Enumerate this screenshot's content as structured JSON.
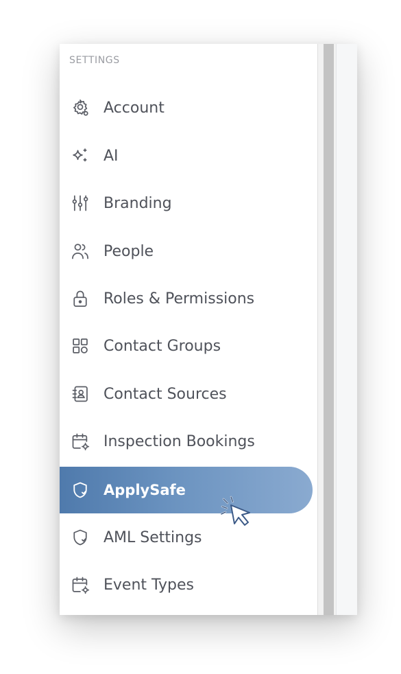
{
  "sidebar": {
    "section_title": "SETTINGS",
    "active_index": 8,
    "accent_gradient": [
      "#4f7aac",
      "#8aaad0"
    ],
    "items": [
      {
        "label": "Account",
        "icon": "gear-icon"
      },
      {
        "label": "AI",
        "icon": "sparkles-icon"
      },
      {
        "label": "Branding",
        "icon": "sliders-icon"
      },
      {
        "label": "People",
        "icon": "people-icon"
      },
      {
        "label": "Roles & Permissions",
        "icon": "lock-icon"
      },
      {
        "label": "Contact Groups",
        "icon": "grid-icon"
      },
      {
        "label": "Contact Sources",
        "icon": "contact-book-icon"
      },
      {
        "label": "Inspection Bookings",
        "icon": "calendar-gear-icon"
      },
      {
        "label": "ApplySafe",
        "icon": "shield-check-icon"
      },
      {
        "label": "AML Settings",
        "icon": "shield-check-icon"
      },
      {
        "label": "Event Types",
        "icon": "calendar-gear-icon"
      }
    ]
  },
  "cursor": {
    "icon": "pointer-cursor-icon",
    "state": "clicking"
  }
}
